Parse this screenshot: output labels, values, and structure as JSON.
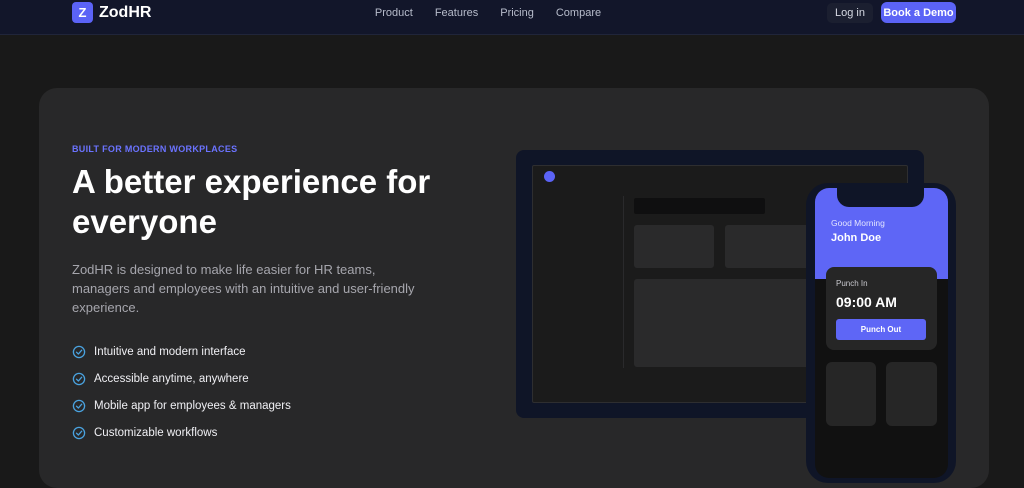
{
  "brand": {
    "logo_letter": "Z",
    "name": "ZodHR",
    "accent": "#5b63f6"
  },
  "nav": {
    "links": [
      "Product",
      "Features",
      "Pricing",
      "Compare"
    ]
  },
  "header": {
    "login_label": "Log in",
    "demo_label": "Book a Demo"
  },
  "hero": {
    "eyebrow": "BUILT FOR MODERN WORKPLACES",
    "headline": "A better experience for everyone",
    "description": "ZodHR is designed to make life easier for HR teams, managers and employees with an intuitive and user-friendly experience.",
    "features": [
      {
        "icon": "check-circle-icon",
        "label": "Intuitive and modern interface"
      },
      {
        "icon": "check-circle-icon",
        "label": "Accessible anytime, anywhere"
      },
      {
        "icon": "check-circle-icon",
        "label": "Mobile app for employees & managers"
      },
      {
        "icon": "check-circle-icon",
        "label": "Customizable workflows"
      }
    ]
  },
  "phone": {
    "greeting": "Good Morning",
    "user_name": "John Doe",
    "punch_label": "Punch In",
    "punch_time": "09:00 AM",
    "punch_button": "Punch Out"
  }
}
